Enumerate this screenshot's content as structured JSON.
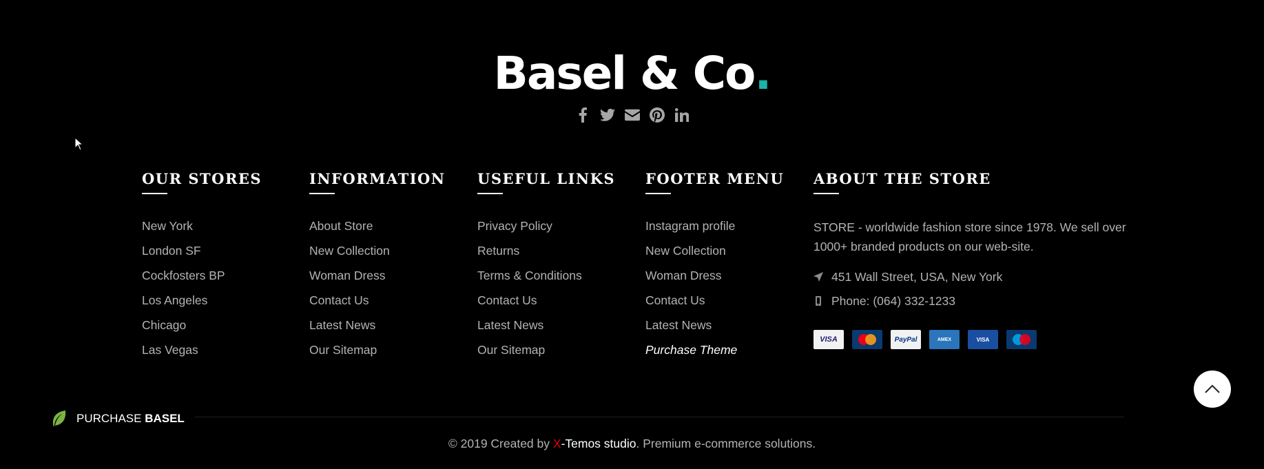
{
  "brand": {
    "name": "Basel & Co",
    "dot": ".",
    "accent": "#1cb3a8"
  },
  "social": [
    "facebook-icon",
    "twitter-icon",
    "email-icon",
    "pinterest-icon",
    "linkedin-icon"
  ],
  "columns": [
    {
      "title": "OUR STORES",
      "items": [
        "New York",
        "London SF",
        "Cockfosters BP",
        "Los Angeles",
        "Chicago",
        "Las Vegas"
      ]
    },
    {
      "title": "INFORMATION",
      "items": [
        "About Store",
        "New Collection",
        "Woman Dress",
        "Contact Us",
        "Latest News",
        "Our Sitemap"
      ]
    },
    {
      "title": "USEFUL LINKS",
      "items": [
        "Privacy Policy",
        "Returns",
        "Terms & Conditions",
        "Contact Us",
        "Latest News",
        "Our Sitemap"
      ]
    },
    {
      "title": "FOOTER MENU",
      "items": [
        "Instagram profile",
        "New Collection",
        "Woman Dress",
        "Contact Us",
        "Latest News",
        "Purchase Theme"
      ]
    }
  ],
  "about": {
    "title": "ABOUT THE STORE",
    "text": "STORE - worldwide fashion store since 1978. We sell over 1000+ branded products on our web-site.",
    "address": "451 Wall Street, USA, New York",
    "phone": "Phone: (064) 332-1233",
    "cards": [
      "VISA",
      "MasterCard",
      "PayPal",
      "AMERICAN EXPRESS",
      "VISA Electron",
      "Maestro"
    ]
  },
  "purchase": {
    "prefix": "PURCHASE ",
    "name": "BASEL"
  },
  "copyright": {
    "before": "© 2019 Created by ",
    "x": "X",
    "studio": "-Temos studio",
    "after": ". Premium e-commerce solutions."
  }
}
